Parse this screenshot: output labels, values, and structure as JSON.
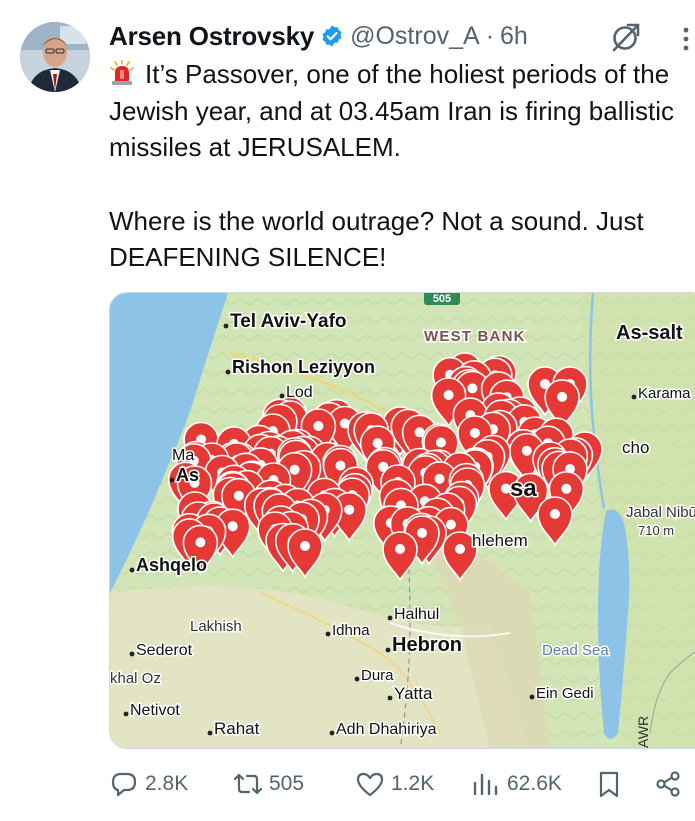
{
  "tweet": {
    "author": {
      "display_name": "Arsen Ostrovsky",
      "handle": "@Ostrov_A",
      "separator": "·",
      "timestamp": "6h"
    },
    "text": {
      "line1": "It’s Passover, one of the holiest periods of the Jewish year, and at 03.45am Iran is firing ballistic missiles at JERUSALEM.",
      "line2": "Where is the world outrage? Not a sound. Just DEAFENING SILENCE!"
    },
    "map": {
      "labels": {
        "tel_aviv": "Tel Aviv-Yafo",
        "west_bank": "WEST BANK",
        "as_salt": "As-salt",
        "rishon": "Rishon Leziyyon",
        "lod": "Lod",
        "karama": "Karama",
        "ma": "Ma",
        "as": "As",
        "cho": "cho",
        "sa": "sa",
        "jabal_nibu": "Jabal Nibū",
        "elevation": "710 m",
        "bethlehem": "hlehem",
        "ashqel": "Ashqelo",
        "lakhish": "Lakhish",
        "halhul": "Halhul",
        "idhna": "Idhna",
        "sederot": "Sederot",
        "hebron": "Hebron",
        "dead_sea": "Dead Sea",
        "khal_oz": "khal Oz",
        "dura": "Dura",
        "yatta": "Yatta",
        "ein_gedi": "Ein Gedi",
        "netivot": "Netivot",
        "rahat": "Rahat",
        "adh_dhahiriya": "Adh Dhahiriya",
        "highway": "505",
        "road_side": "AWR"
      },
      "pin_color": "#e53935"
    },
    "actions": {
      "replies": "2.8K",
      "reposts": "505",
      "likes": "1.2K",
      "views": "62.6K"
    },
    "colors": {
      "verified": "#1d9bf0",
      "muted": "#536471"
    }
  }
}
